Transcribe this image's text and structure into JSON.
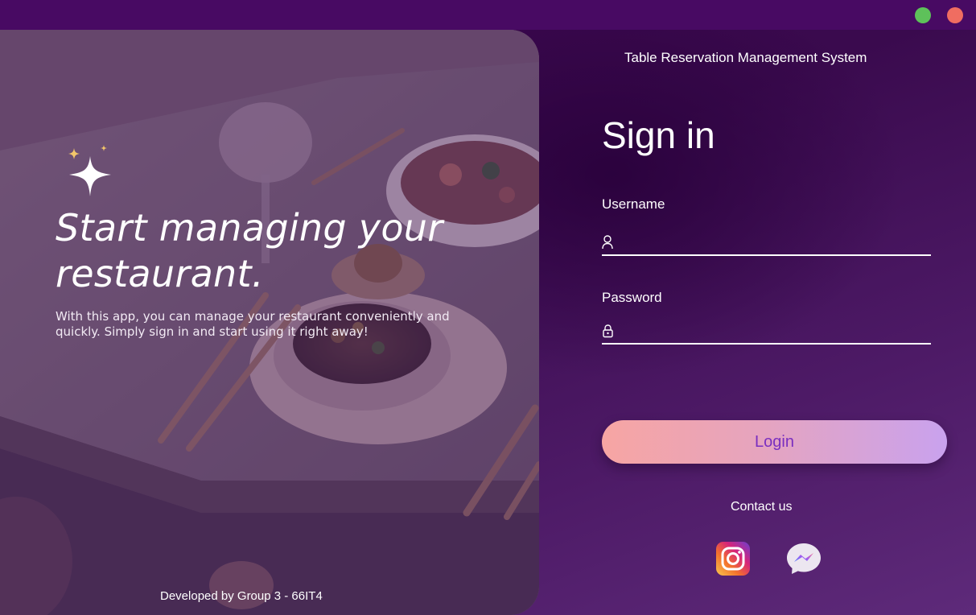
{
  "window": {
    "controls": [
      "green-dot",
      "red-dot"
    ]
  },
  "hero": {
    "title": "Start managing your restaurant.",
    "description": "With this app, you can manage your restaurant conveniently and quickly. Simply sign in and start using it right away!",
    "credit": "Developed by Group 3 - 66IT4"
  },
  "form": {
    "system_title": "Table Reservation Management System",
    "heading": "Sign in",
    "username_label": "Username",
    "username_value": "",
    "password_label": "Password",
    "password_value": "",
    "login_label": "Login"
  },
  "contact": {
    "label": "Contact us",
    "icons": [
      "instagram-icon",
      "messenger-icon"
    ]
  },
  "colors": {
    "titlebar": "#480a63",
    "background": "#3a0a4e",
    "login_gradient_start": "#f7a5a3",
    "login_gradient_end": "#c9a2ee",
    "login_text": "#7a2fc0"
  }
}
